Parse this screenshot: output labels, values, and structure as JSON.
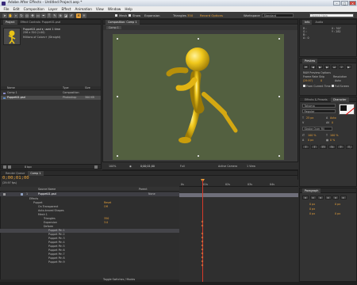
{
  "window": {
    "title": "Adobe After Effects - Untitled Project.aep *"
  },
  "menu": [
    "File",
    "Edit",
    "Composition",
    "Layer",
    "Effect",
    "Animation",
    "View",
    "Window",
    "Help"
  ],
  "toolbar": {
    "checkboxes": [
      "Mesh",
      "Show",
      "Expansion"
    ],
    "triangles_label": "Triangles",
    "triangles_value": "350",
    "record_label": "Record Options",
    "workspace_label": "Workspace",
    "workspace_value": "Standard",
    "search_placeholder": "Search Help"
  },
  "project_panel": {
    "tab": "Project",
    "tab2": "Effect Controls: Puppet01.psd",
    "item_name": "Puppet01.psd ▾, used 1 time",
    "item_dims": "256 x 320 (1.00)",
    "item_depth": "Millions of Colors+ (Straight)",
    "columns": [
      "Name",
      "Type",
      "Size"
    ],
    "items": [
      {
        "name": "Comp 1",
        "type": "Composition",
        "size": ""
      },
      {
        "name": "Puppet01.psd",
        "type": "Photoshop",
        "size": "300 KB"
      }
    ],
    "footer": "8 bpc"
  },
  "comp_panel": {
    "tab": "Composition: Comp 1",
    "subtab": "Comp 1",
    "zoom": "100%",
    "timecode": "0;00;01;00",
    "resolution": "Full",
    "camera": "Active Camera",
    "views": "1 View"
  },
  "info_panel": {
    "tab": "Info",
    "tab2": "Audio",
    "r": "R :",
    "g": "G :",
    "b": "B :",
    "a": "A : 0",
    "x": "X : 307",
    "y": "Y : 282"
  },
  "preview_panel": {
    "tab": "Preview",
    "options_label": "RAM Preview Options",
    "frame_rate_label": "Frame Rate",
    "frame_rate": "(29.97)",
    "skip_label": "Skip",
    "skip": "0",
    "resolution_label": "Resolution",
    "resolution": "Auto",
    "from_label": "From Current Time",
    "full_screen_label": "Full Screen"
  },
  "character_panel": {
    "tab": "Effects & Presets",
    "tab2": "Character",
    "font": "Tahoma",
    "style": "Regular",
    "size": "25 px",
    "leading": "Auto",
    "tracking": "0",
    "stroke": "Stroke Over Fill",
    "scale_v": "100 %",
    "scale_h": "100 %",
    "baseline": "0 px",
    "tsume": "0 %",
    "styles": [
      "T",
      "T",
      "TT",
      "Tt",
      "T'",
      "T,"
    ]
  },
  "paragraph_panel": {
    "tab": "Paragraph",
    "values": [
      "0 px",
      "0 px",
      "0 px",
      "0 px",
      "0 px"
    ]
  },
  "timeline": {
    "tab": "Render Queue",
    "tab2": "Comp 1",
    "timecode": "0;00;01;00",
    "fps": "(29.97 fps)",
    "columns": [
      "Source Name",
      "Parent"
    ],
    "layer_num": "1",
    "layer_name": "Puppet01.psd",
    "parent": "None",
    "props": [
      {
        "name": "Effects",
        "value": ""
      },
      {
        "name": "Puppet",
        "value": "Reset"
      },
      {
        "name": "On Transparent",
        "value": "Off"
      },
      {
        "name": "Auto-traced Shapes",
        "value": ""
      },
      {
        "name": "Mesh 1",
        "value": ""
      },
      {
        "name": "Triangles",
        "value": "350"
      },
      {
        "name": "Expansion",
        "value": "3.0"
      },
      {
        "name": "Deform",
        "value": ""
      },
      {
        "name": "Puppet Pin 1",
        "value": ""
      },
      {
        "name": "Puppet Pin 2",
        "value": ""
      },
      {
        "name": "Puppet Pin 3",
        "value": ""
      },
      {
        "name": "Puppet Pin 4",
        "value": ""
      },
      {
        "name": "Puppet Pin 5",
        "value": ""
      },
      {
        "name": "Puppet Pin 6",
        "value": ""
      },
      {
        "name": "Puppet Pin 7",
        "value": ""
      },
      {
        "name": "Puppet Pin 8",
        "value": ""
      },
      {
        "name": "Puppet Pin 9",
        "value": ""
      }
    ],
    "ruler": [
      "0s",
      "01s",
      "02s",
      "03s",
      "04s"
    ],
    "footer_label": "Toggle Switches / Modes"
  },
  "colors": {
    "accent_orange": "#e8a23a",
    "playhead_red": "#d63a2a",
    "canvas_green": "#536040",
    "puppet_yellow": "#e9c317"
  }
}
